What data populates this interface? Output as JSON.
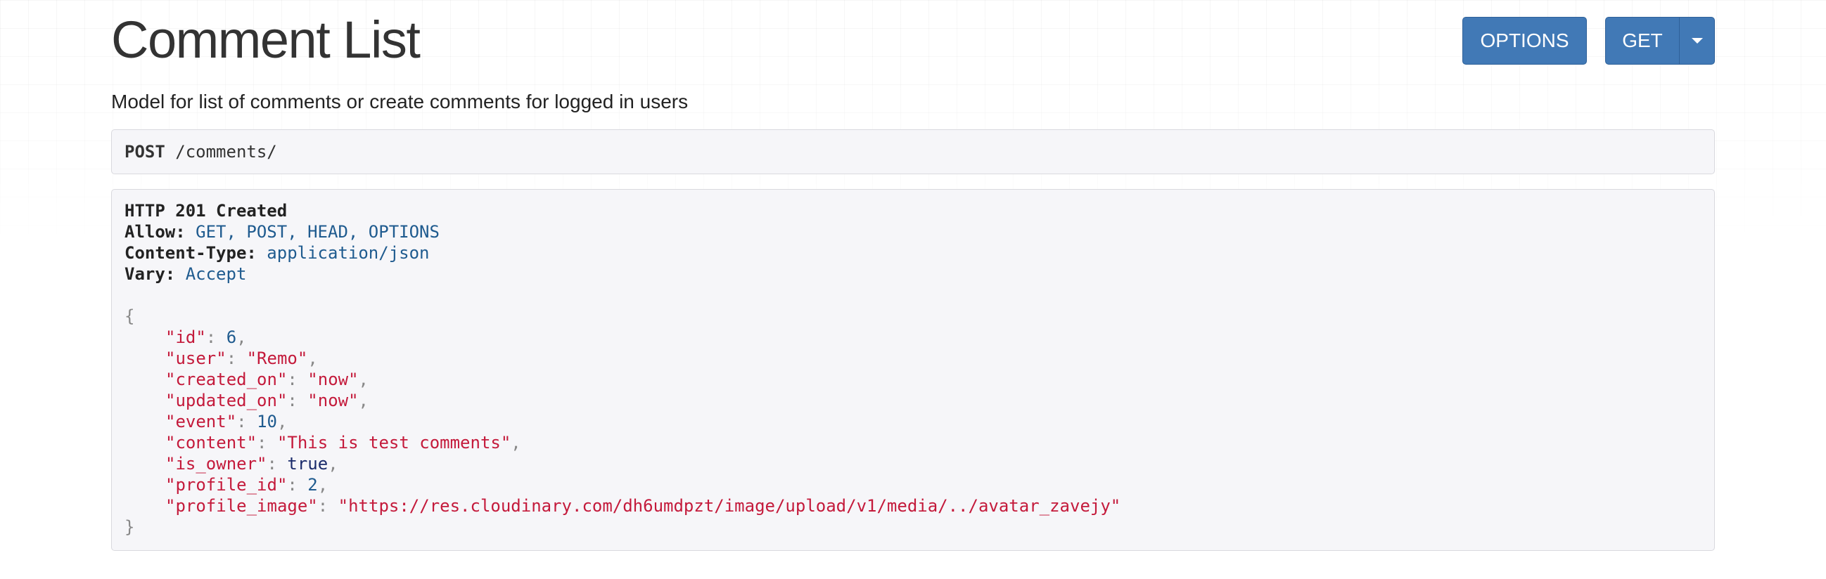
{
  "page": {
    "title": "Comment List",
    "description": "Model for list of comments or create comments for logged in users"
  },
  "toolbar": {
    "options_label": "OPTIONS",
    "get_label": "GET"
  },
  "request": {
    "method": "POST",
    "path": "/comments/"
  },
  "response": {
    "status_line": "HTTP 201 Created",
    "headers": [
      {
        "name": "Allow:",
        "value": "GET, POST, HEAD, OPTIONS"
      },
      {
        "name": "Content-Type:",
        "value": "application/json"
      },
      {
        "name": "Vary:",
        "value": "Accept"
      }
    ],
    "body_open": "{",
    "body_close": "}",
    "fields": [
      {
        "key": "\"id\"",
        "value": "6",
        "type": "num",
        "comma": ","
      },
      {
        "key": "\"user\"",
        "value": "\"Remo\"",
        "type": "str",
        "comma": ","
      },
      {
        "key": "\"created_on\"",
        "value": "\"now\"",
        "type": "str",
        "comma": ","
      },
      {
        "key": "\"updated_on\"",
        "value": "\"now\"",
        "type": "str",
        "comma": ","
      },
      {
        "key": "\"event\"",
        "value": "10",
        "type": "num",
        "comma": ","
      },
      {
        "key": "\"content\"",
        "value": "\"This is test comments\"",
        "type": "str",
        "comma": ","
      },
      {
        "key": "\"is_owner\"",
        "value": "true",
        "type": "lit",
        "comma": ","
      },
      {
        "key": "\"profile_id\"",
        "value": "2",
        "type": "num",
        "comma": ","
      },
      {
        "key": "\"profile_image\"",
        "value": "\"https://res.cloudinary.com/dh6umdpzt/image/upload/v1/media/../avatar_zavejy\"",
        "type": "str",
        "comma": ""
      }
    ]
  },
  "colors": {
    "button_bg": "#4179b6",
    "string": "#c41a3b",
    "number": "#1f5b8f",
    "header_value": "#1f5b8f"
  },
  "icons": {
    "dropdown": "caret-down-icon"
  }
}
